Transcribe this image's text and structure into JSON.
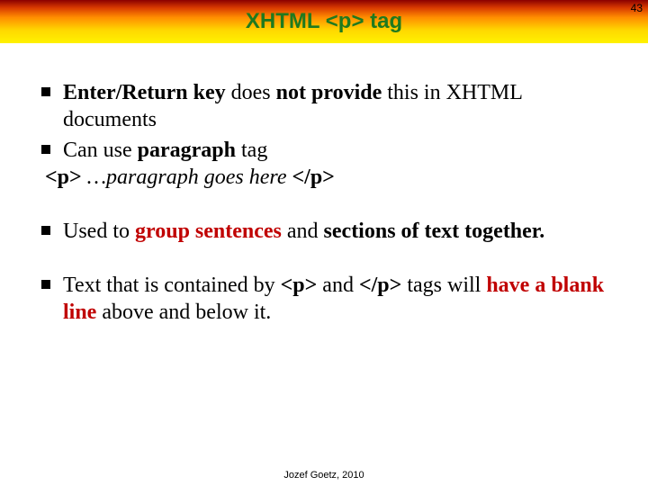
{
  "page_number": "43",
  "title": "XHTML <p> tag",
  "b1": {
    "t1": "Enter/Return key",
    "t2": " does ",
    "t3": "not provide",
    "t4": " this in XHTML documents"
  },
  "b2": {
    "t1": "Can use ",
    "t2": "paragraph",
    "t3": " tag"
  },
  "line3": {
    "t1": "<p>",
    "t2": " …paragraph goes here ",
    "t3": "</p>"
  },
  "b4": {
    "t1": "Used to ",
    "t2": "group sentences",
    "t3": " and ",
    "t4": "sections of text together."
  },
  "b5": {
    "t1": "Text that is contained by ",
    "t2": "<p>",
    "t3": " and ",
    "t4": "</p>",
    "t5": " tags will ",
    "t6": "have a blank line",
    "t7": " above and below it."
  },
  "footer": "Jozef Goetz, 2010"
}
